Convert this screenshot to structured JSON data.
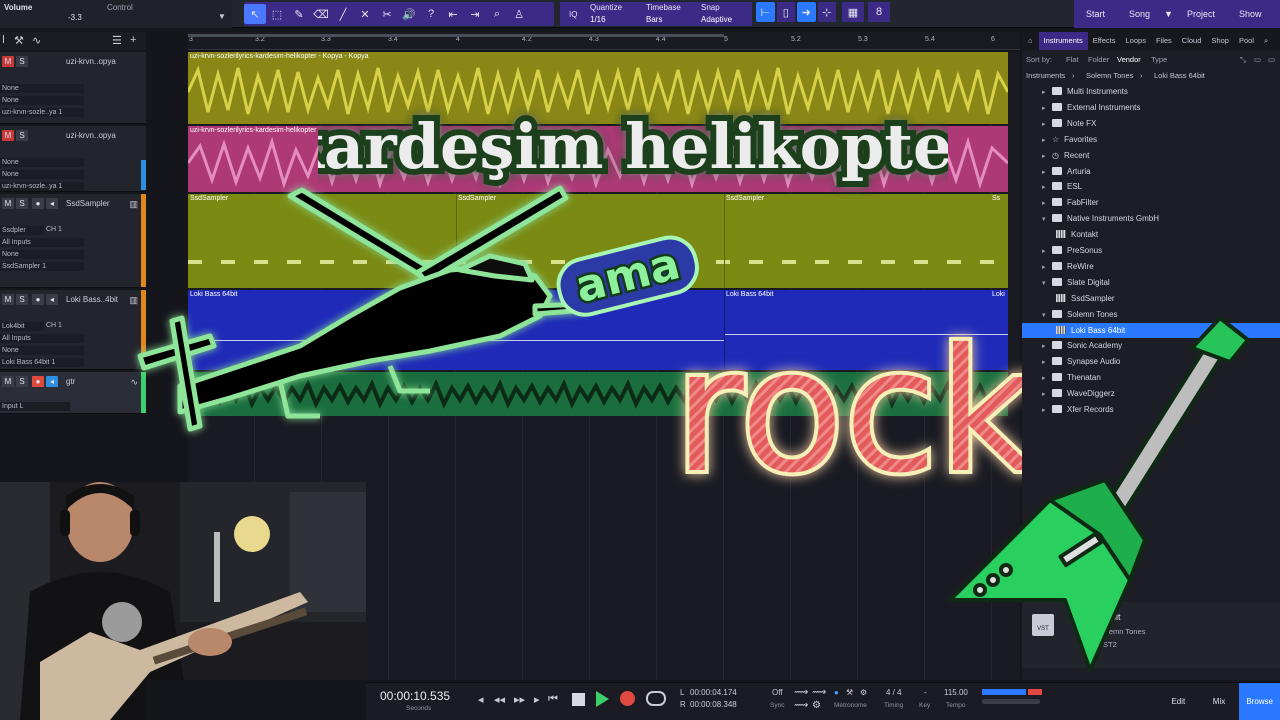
{
  "toolbar": {
    "volume_label": "Volume",
    "volume_value": "-3.3",
    "control_label": "Control",
    "quantize_label": "Quantize",
    "quantize_value": "1/16",
    "timebase_label": "Timebase",
    "timebase_value": "Bars",
    "snap_label": "Snap",
    "snap_value": "Adaptive",
    "iq_label": "IQ",
    "nav": {
      "start": "Start",
      "song": "Song",
      "project": "Project",
      "show": "Show"
    }
  },
  "ruler": {
    "ticks": [
      "3",
      "3.2",
      "3.3",
      "3.4",
      "4",
      "4.2",
      "4.3",
      "4.4",
      "5",
      "5.2",
      "5.3",
      "5.4",
      "6"
    ]
  },
  "tracks": [
    {
      "name": "uzi-krvn..opya",
      "row1": "None",
      "row2": "None",
      "row3": "uzi-krvn-sozle..ya 1",
      "color": "#8b8717"
    },
    {
      "name": "uzi-krvn..opya",
      "row1": "None",
      "row2": "None",
      "row3": "uzi-krvn-sozle..ya 1",
      "color": "#2e8fe0"
    },
    {
      "name": "SsdSampler",
      "row1": "Ssdpler",
      "row1b": "CH 1",
      "row2": "All Inputs",
      "row3": "None",
      "row4": "SsdSampler 1",
      "color": "#e2861f"
    },
    {
      "name": "Loki Bass..4bit",
      "row1": "Lok4bit",
      "row1b": "CH 1",
      "row2": "All Inputs",
      "row3": "None",
      "row4": "Loki Bass 64bit 1",
      "color": "#e2861f"
    },
    {
      "name": "gtr",
      "row1": "Input L",
      "color": "#3bd26b"
    }
  ],
  "clips": {
    "lane1": "uzi-krvn-sozlerilyrics-kardesim-helikopter - Kopya - Kopya",
    "lane2": "uzi-krvn-sozlerilyrics-kardesim-helikopter",
    "lane3a": "SsdSampler",
    "lane3b": "SsdSampler",
    "lane3c": "SsdSampler",
    "lane3d": "Ss",
    "lane4a": "Loki Bass 64bit",
    "lane4b": "Loki Bass 64bit",
    "lane4c": "Loki"
  },
  "overlay": {
    "title": "kardeşim helikopter",
    "ama": "ama",
    "rock": "rock"
  },
  "browser": {
    "tabs": [
      "Instruments",
      "Effects",
      "Loops",
      "Files",
      "Cloud",
      "Shop",
      "Pool"
    ],
    "sort_label": "Sort by:",
    "sort_options": [
      "Flat",
      "Folder",
      "Vendor",
      "Type"
    ],
    "breadcrumb": [
      "Instruments",
      "Solemn Tones",
      "Loki Bass 64bit"
    ],
    "tree": [
      {
        "label": "Multi Instruments",
        "icon": "folder",
        "indent": 0
      },
      {
        "label": "External Instruments",
        "icon": "folder",
        "indent": 0
      },
      {
        "label": "Note FX",
        "icon": "folder",
        "indent": 0
      },
      {
        "label": "Favorites",
        "icon": "star",
        "indent": 0
      },
      {
        "label": "Recent",
        "icon": "clock",
        "indent": 0
      },
      {
        "label": "Arturia",
        "icon": "folder",
        "indent": 0
      },
      {
        "label": "ESL",
        "icon": "folder",
        "indent": 0
      },
      {
        "label": "FabFilter",
        "icon": "folder",
        "indent": 0
      },
      {
        "label": "Native Instruments GmbH",
        "icon": "folder",
        "indent": 0,
        "open": true
      },
      {
        "label": "Kontakt",
        "icon": "kbd",
        "indent": 1
      },
      {
        "label": "PreSonus",
        "icon": "folder",
        "indent": 0
      },
      {
        "label": "ReWire",
        "icon": "folder",
        "indent": 0
      },
      {
        "label": "Slate Digital",
        "icon": "folder",
        "indent": 0,
        "open": true
      },
      {
        "label": "SsdSampler",
        "icon": "kbd",
        "indent": 1
      },
      {
        "label": "Solemn Tones",
        "icon": "folder",
        "indent": 0,
        "open": true
      },
      {
        "label": "Loki Bass 64bit",
        "icon": "kbd",
        "indent": 1,
        "selected": true
      },
      {
        "label": "Sonic Academy",
        "icon": "folder",
        "indent": 0
      },
      {
        "label": "Synapse Audio",
        "icon": "folder",
        "indent": 0
      },
      {
        "label": "Thenatan",
        "icon": "folder",
        "indent": 0
      },
      {
        "label": "WaveDiggerz",
        "icon": "folder",
        "indent": 0
      },
      {
        "label": "Xfer Records",
        "icon": "folder",
        "indent": 0
      }
    ],
    "footer": {
      "name": "s 64bit",
      "vendor": "Solemn Tones",
      "format": "VST2",
      "badge": "VST"
    }
  },
  "transport": {
    "time": "00:00:10.535",
    "time_unit": "Seconds",
    "loop_l": "00:00:04.174",
    "loop_r": "00:00:08.348",
    "l_label": "L",
    "r_label": "R",
    "sync_value": "Off",
    "sync_label": "Sync",
    "metronome_label": "Metronome",
    "timing_value": "4 / 4",
    "timing_label": "Timing",
    "key_value": "-",
    "key_label": "Key",
    "tempo_value": "115.00",
    "tempo_label": "Tempo",
    "edit": "Edit",
    "mix": "Mix",
    "browse": "Browse"
  },
  "colors": {
    "accent": "#3b2a86",
    "select": "#2a79ff",
    "title_green": "#2d5a2d"
  }
}
